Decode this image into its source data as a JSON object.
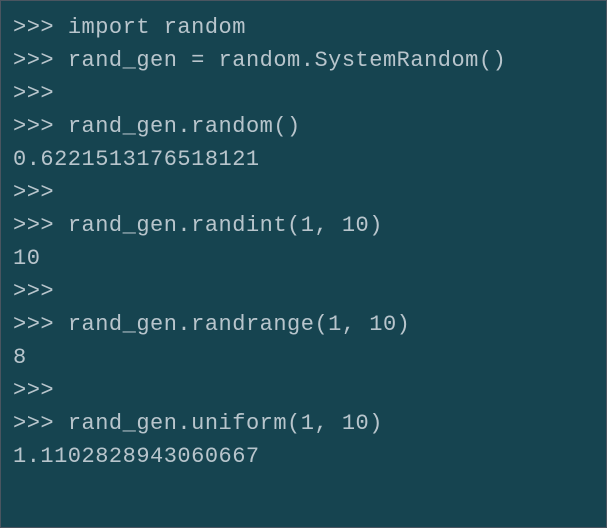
{
  "lines": [
    {
      "prompt": ">>> ",
      "code": "import random"
    },
    {
      "prompt": ">>> ",
      "code": "rand_gen = random.SystemRandom()"
    },
    {
      "prompt": ">>>",
      "code": ""
    },
    {
      "prompt": ">>> ",
      "code": "rand_gen.random()"
    },
    {
      "output": "0.6221513176518121"
    },
    {
      "prompt": ">>>",
      "code": ""
    },
    {
      "prompt": ">>> ",
      "code": "rand_gen.randint(1, 10)"
    },
    {
      "output": "10"
    },
    {
      "prompt": ">>>",
      "code": ""
    },
    {
      "prompt": ">>> ",
      "code": "rand_gen.randrange(1, 10)"
    },
    {
      "output": "8"
    },
    {
      "prompt": ">>>",
      "code": ""
    },
    {
      "prompt": ">>> ",
      "code": "rand_gen.uniform(1, 10)"
    },
    {
      "output": "1.1102828943060667"
    }
  ]
}
